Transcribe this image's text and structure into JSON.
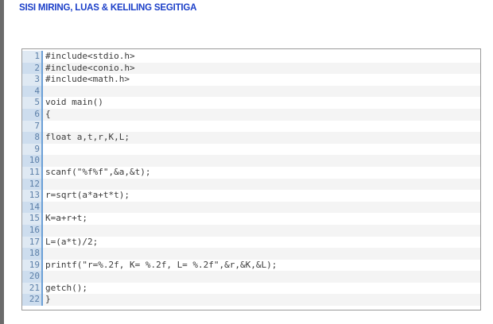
{
  "page": {
    "title": "SISI MIRING, LUAS & KELILING SEGITIGA"
  },
  "code": {
    "lines": [
      "#include<stdio.h>",
      "#include<conio.h>",
      "#include<math.h>",
      "",
      "void main()",
      "{",
      "",
      "float a,t,r,K,L;",
      "",
      "",
      "scanf(\"%f%f\",&a,&t);",
      "",
      "r=sqrt(a*a+t*t);",
      "",
      "K=a+r+t;",
      "",
      "L=(a*t)/2;",
      "",
      "printf(\"r=%.2f, K= %.2f, L= %.2f\",&r,&K,&L);",
      "",
      "getch();",
      "}"
    ]
  },
  "colors": {
    "title": "#1a3ec8",
    "line_number": "#5b7fa8",
    "gutter_accent": "#6ca0d6",
    "code_text": "#3a3a3a"
  }
}
